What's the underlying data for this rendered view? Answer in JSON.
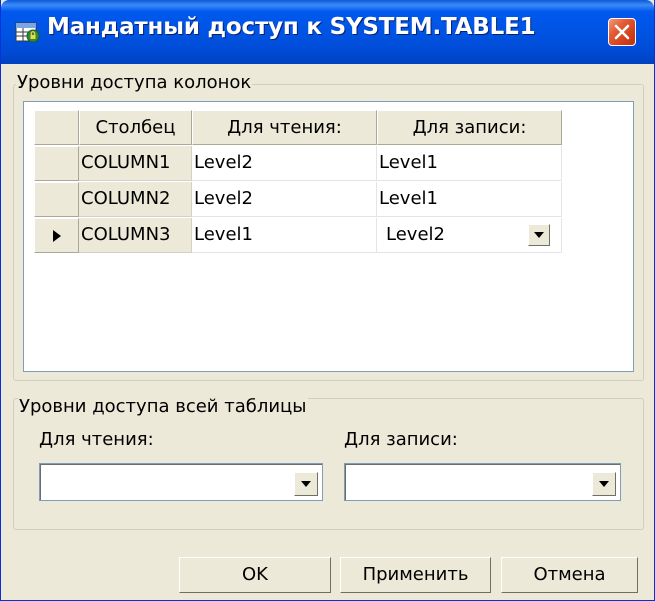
{
  "window": {
    "title": "Мандатный доступ к SYSTEM.TABLE1",
    "icon": "table-security-icon",
    "close_icon": "close-icon"
  },
  "column_levels": {
    "caption": "Уровни доступа колонок",
    "headers": [
      "Столбец",
      "Для чтения:",
      "Для записи:"
    ],
    "rows": [
      {
        "column": "COLUMN1",
        "read": "Level2",
        "write": "Level1",
        "current": false
      },
      {
        "column": "COLUMN2",
        "read": "Level2",
        "write": "Level1",
        "current": false
      },
      {
        "column": "COLUMN3",
        "read": "Level1",
        "write": "Level2",
        "current": true
      }
    ]
  },
  "table_levels": {
    "caption": "Уровни доступа всей таблицы",
    "read_label": "Для чтения:",
    "write_label": "Для записи:",
    "read_value": "",
    "write_value": ""
  },
  "buttons": {
    "ok": "OK",
    "apply": "Применить",
    "cancel": "Отмена"
  },
  "colors": {
    "titlebar": "#0054e3",
    "dialog_bg": "#ece9d8",
    "close_button": "#d2401b"
  }
}
